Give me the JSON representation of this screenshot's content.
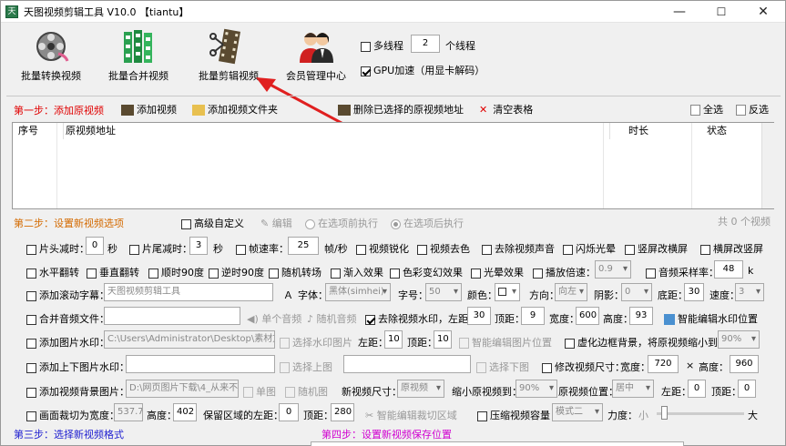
{
  "window": {
    "title": "天图视频剪辑工具 V10.0  【tiantu】",
    "min": "—",
    "max": "☐",
    "close": "✕"
  },
  "toolbar": [
    {
      "label": "批量转换视频",
      "icon": "film-reel-icon"
    },
    {
      "label": "批量合并视频",
      "icon": "film-strips-icon"
    },
    {
      "label": "批量剪辑视频",
      "icon": "film-edit-icon"
    },
    {
      "label": "会员管理中心",
      "icon": "members-icon"
    }
  ],
  "threads": {
    "label": "多线程",
    "value": "2",
    "unit": "个线程"
  },
  "gpu": {
    "label": "GPU加速（用显卡解码）"
  },
  "step1": {
    "title": "第一步：添加原视频",
    "add_video": "添加视频",
    "add_folder": "添加视频文件夹",
    "delete_selected": "删除已选择的原视频地址",
    "clear": "清空表格",
    "select_all": "全选",
    "invert": "反选"
  },
  "table": {
    "headers": [
      "序号",
      "原视频地址",
      "时长",
      "状态"
    ]
  },
  "step2": {
    "title": "第二步：设置新视频选项",
    "advanced": "高级自定义",
    "edit": "编辑",
    "before": "在选项前执行",
    "after": "在选项后执行",
    "count": "共 0 个视频"
  },
  "r1": {
    "head": "片头减时：",
    "head_v": "0",
    "head_u": "秒",
    "tail": "片尾减时：",
    "tail_v": "3",
    "tail_u": "秒",
    "fps": "帧速率：",
    "fps_v": "25",
    "fps_u": "帧/秒",
    "sharpen": "视频锐化",
    "denoise": "视频去色",
    "remove_audio": "去除视频声音",
    "flash": "闪烁光晕",
    "v2h": "竖屏改横屏",
    "h2v": "横屏改竖屏"
  },
  "r2": {
    "hflip": "水平翻转",
    "vflip": "垂直翻转",
    "cw90": "顺时90度",
    "ccw90": "逆时90度",
    "transition": "随机转场",
    "fadein": "渐入效果",
    "color": "色彩变幻效果",
    "halo": "光晕效果",
    "speed": "播放倍速：",
    "speed_v": "0.9",
    "sample": "音频采样率：",
    "sample_v": "48",
    "sample_u": "k"
  },
  "r3": {
    "subtitle": "添加滚动字幕：",
    "subtitle_v": "天图视频剪辑工具",
    "font": "字体：",
    "font_v": "黑体(simhei)",
    "size": "字号：",
    "size_v": "50",
    "color": "颜色：",
    "dir": "方向：",
    "dir_v": "向左",
    "shadow": "阴影：",
    "shadow_v": "0",
    "bottom": "底距：",
    "bottom_v": "30",
    "speed": "速度：",
    "speed_v": "3"
  },
  "r4": {
    "audio": "合并音频文件：",
    "single": "单个音频",
    "random": "随机音频",
    "remove_wm": "去除视频水印，左距：",
    "left_v": "30",
    "top": "顶距：",
    "top_v": "9",
    "width": "宽度：",
    "width_v": "600",
    "height": "高度：",
    "height_v": "93",
    "smart": "智能编辑水印位置"
  },
  "r5": {
    "img_wm": "添加图片水印：",
    "path": "C:\\Users\\Administrator\\Desktop\\素材文",
    "choose": "选择水印图片",
    "left": "左距：",
    "left_v": "10",
    "top": "顶距：",
    "top_v": "10",
    "smart": "智能编辑图片位置",
    "blur": "虚化边框背景，将原视频缩小到：",
    "blur_v": "90%"
  },
  "r6": {
    "tb_wm": "添加上下图片水印：",
    "choose": "选择上图",
    "choose2": "选择下图",
    "resize": "修改视频尺寸：",
    "width": "宽度：",
    "width_v": "720",
    "x": "×",
    "height": "高度：",
    "height_v": "960"
  },
  "r7": {
    "bg": "添加视频背景图片：",
    "path": "D:\\网页图片下载\\4_从来不",
    "single": "单图",
    "random": "随机图",
    "newsize": "新视频尺寸：",
    "newsize_v": "原视频",
    "shrink": "缩小原视频到：",
    "shrink_v": "90%",
    "pos": "原视频位置：",
    "pos_v": "居中",
    "left": "左距：",
    "left_v": "0",
    "top": "顶距：",
    "top_v": "0"
  },
  "r8": {
    "crop": "画面裁切为宽度：",
    "crop_w": "537.7",
    "height": "高度：",
    "height_v": "402",
    "keep": "保留区域的左距：",
    "keep_v": "0",
    "top": "顶距：",
    "top_v": "280",
    "smart": "智能编辑裁切区域",
    "compress": "压缩视频容量",
    "mode_v": "模式二",
    "strength": "力度：",
    "small": "小",
    "big": "大"
  },
  "step3": {
    "title": "第三步：选择新视频格式"
  },
  "step4": {
    "title": "第四步：设置新视频保存位置"
  },
  "colors": {
    "arrow": "#e02020",
    "step1": "#e00000",
    "step2": "#d46a00",
    "step3": "#2020d0",
    "step4": "#d000d0"
  }
}
